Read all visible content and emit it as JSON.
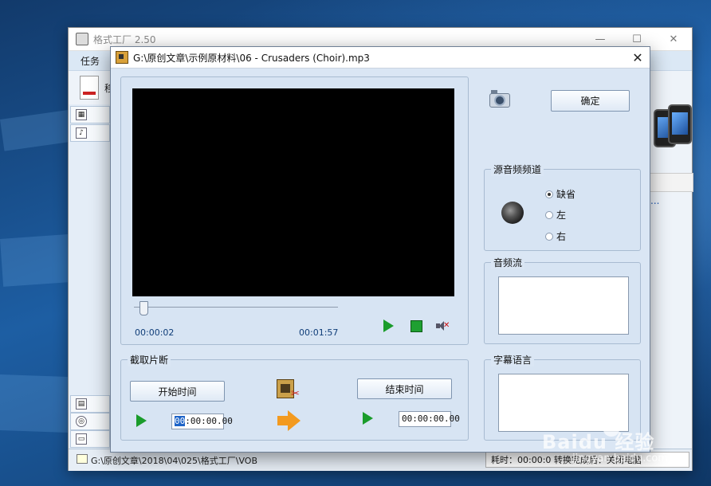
{
  "main_window": {
    "title": "格式工厂 2.50",
    "menu_label": "任务",
    "toolbar_label": "移",
    "status_path": "G:\\原创文章\\2018\\04\\025\\格式工厂\\VOB",
    "status_right": "耗时：00:00:0  转换完成后：关闭电脑",
    "right_ellipsis": "..."
  },
  "dialog": {
    "title": "G:\\原创文章\\示例原材料\\06 - Crusaders (Choir).mp3",
    "confirm_button": "确定",
    "player": {
      "current_time": "00:00:02",
      "total_time": "00:01:57",
      "position_fraction": 0.02
    },
    "clip": {
      "section_title": "截取片断",
      "start_button": "开始时间",
      "end_button": "结束时间",
      "start_time_highlight": "00",
      "start_time_rest": ":00:00.00",
      "end_time": "00:00:00.00"
    },
    "audio_channel": {
      "section_title": "源音频频道",
      "options": [
        "缺省",
        "左",
        "右"
      ],
      "selected": "缺省"
    },
    "audio_stream": {
      "section_title": "音频流"
    },
    "subtitle_lang": {
      "section_title": "字幕语言"
    }
  },
  "watermark": {
    "brand": "Baidu 经验",
    "sub": "jingyan.baidu.com"
  },
  "icons": {
    "app": "format-factory-icon",
    "dialog": "film-icon",
    "play": "play-icon",
    "stop": "stop-icon",
    "mute": "mute-icon",
    "camera": "camera-icon",
    "speaker": "speaker-icon",
    "film_cut": "film-scissors-icon",
    "arrow": "arrow-right-icon"
  },
  "colors": {
    "dialog_bg": "#dae6f4",
    "play_green": "#1a9c2b",
    "time_text": "#0f3d78",
    "selection": "#1e64c8"
  }
}
